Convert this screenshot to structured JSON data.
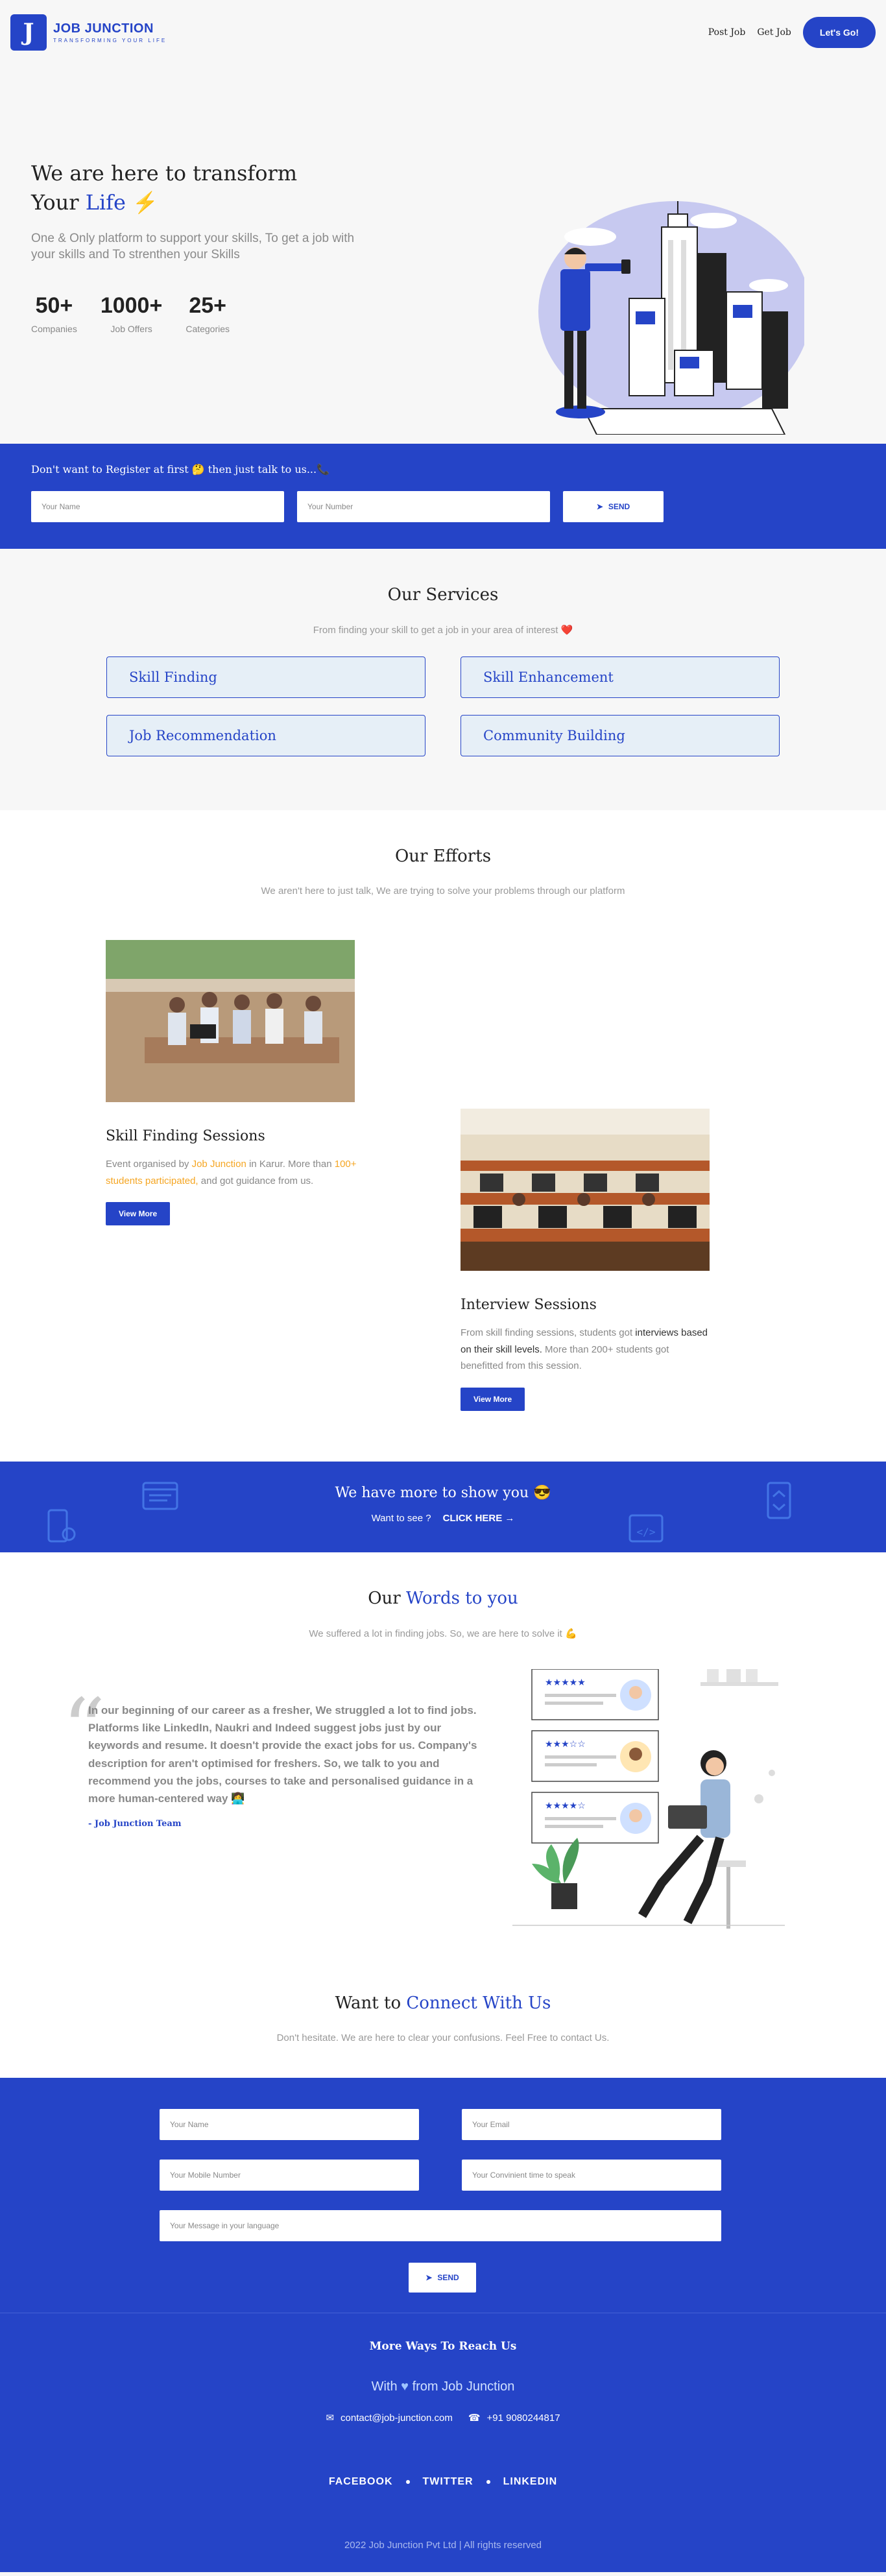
{
  "header": {
    "logo_letter": "J",
    "brand_name": "JOB JUNCTION",
    "brand_tagline": "TRANSFORMING YOUR LIFE",
    "nav": [
      "Post Job",
      "Get Job"
    ],
    "cta": "Let's Go!"
  },
  "hero": {
    "title_line1": "We are here to transform",
    "title_line2_prefix": "Your",
    "title_line2_accent": "Life",
    "title_emoji": "⚡",
    "subtitle": "One & Only platform to support your skills, To get a job with your skills and To strenthen your Skills",
    "stats": [
      {
        "value": "50+",
        "label": "Companies"
      },
      {
        "value": "1000+",
        "label": "Job Offers"
      },
      {
        "value": "25+",
        "label": "Categories"
      }
    ]
  },
  "quick_contact": {
    "title": "Don't want to Register at first 🤔 then just talk to us...📞",
    "name_placeholder": "Your Name",
    "number_placeholder": "Your Number",
    "send_label": "SEND"
  },
  "services": {
    "title": "Our Services",
    "subtitle": "From finding your skill to get a job in your area of interest ❤️",
    "items": [
      "Skill Finding",
      "Skill Enhancement",
      "Job Recommendation",
      "Community Building"
    ]
  },
  "efforts": {
    "title": "Our Efforts",
    "subtitle": "We aren't here to just talk, We are trying to solve your problems through our platform",
    "items": [
      {
        "title": "Skill Finding Sessions",
        "text_a": "Event organised by ",
        "text_b": "Job Junction",
        "text_c": " in Karur. More than ",
        "text_d": "100+ students participated,",
        "text_e": " and got guidance from us.",
        "button": "View More"
      },
      {
        "title": "Interview Sessions",
        "text_a": "From skill finding sessions, students got ",
        "text_b": "interviews based on their skill levels.",
        "text_c": " More than 200+ students got benefitted from this session.",
        "button": "View More"
      }
    ]
  },
  "more": {
    "title": "We have more to show you 😎",
    "prompt": "Want to see ?",
    "link": "CLICK HERE →"
  },
  "words": {
    "title_prefix": "Our",
    "title_accent": "Words to you",
    "subtitle": "We suffered a lot in finding jobs. So, we are here to solve it 💪",
    "quote": "In our beginning of our career as a fresher, We struggled a lot to find jobs. Platforms like LinkedIn, Naukri and Indeed suggest jobs just by our keywords and resume. It doesn't provide the exact jobs for us. Company's description for aren't optimised for freshers. So, we talk to you and recommend you the jobs, courses to take and personalised guidance in a more human-centered way 👩‍💻",
    "author": "- Job Junction Team"
  },
  "connect": {
    "title_prefix": "Want to",
    "title_accent": "Connect With Us",
    "subtitle": "Don't hesitate. We are here to clear your confusions. Feel Free to contact Us."
  },
  "contact_form": {
    "name": "Your Name",
    "email": "Your Email",
    "mobile": "Your Mobile Number",
    "time": "Your Convinient time to speak",
    "message": "Your Message in your language",
    "send": "SEND"
  },
  "footer": {
    "more_ways": "More Ways To Reach Us",
    "love_prefix": "With",
    "love_suffix": "from Job Junction",
    "email": "contact@job-junction.com",
    "phone": "+91 9080244817",
    "social": [
      "FACEBOOK",
      "TWITTER",
      "LINKEDIN"
    ],
    "copyright": "2022 Job Junction Pvt Ltd | All rights reserved"
  },
  "colors": {
    "primary": "#2544c7",
    "highlight": "#f5a623",
    "light_panel": "#e6eff7"
  }
}
